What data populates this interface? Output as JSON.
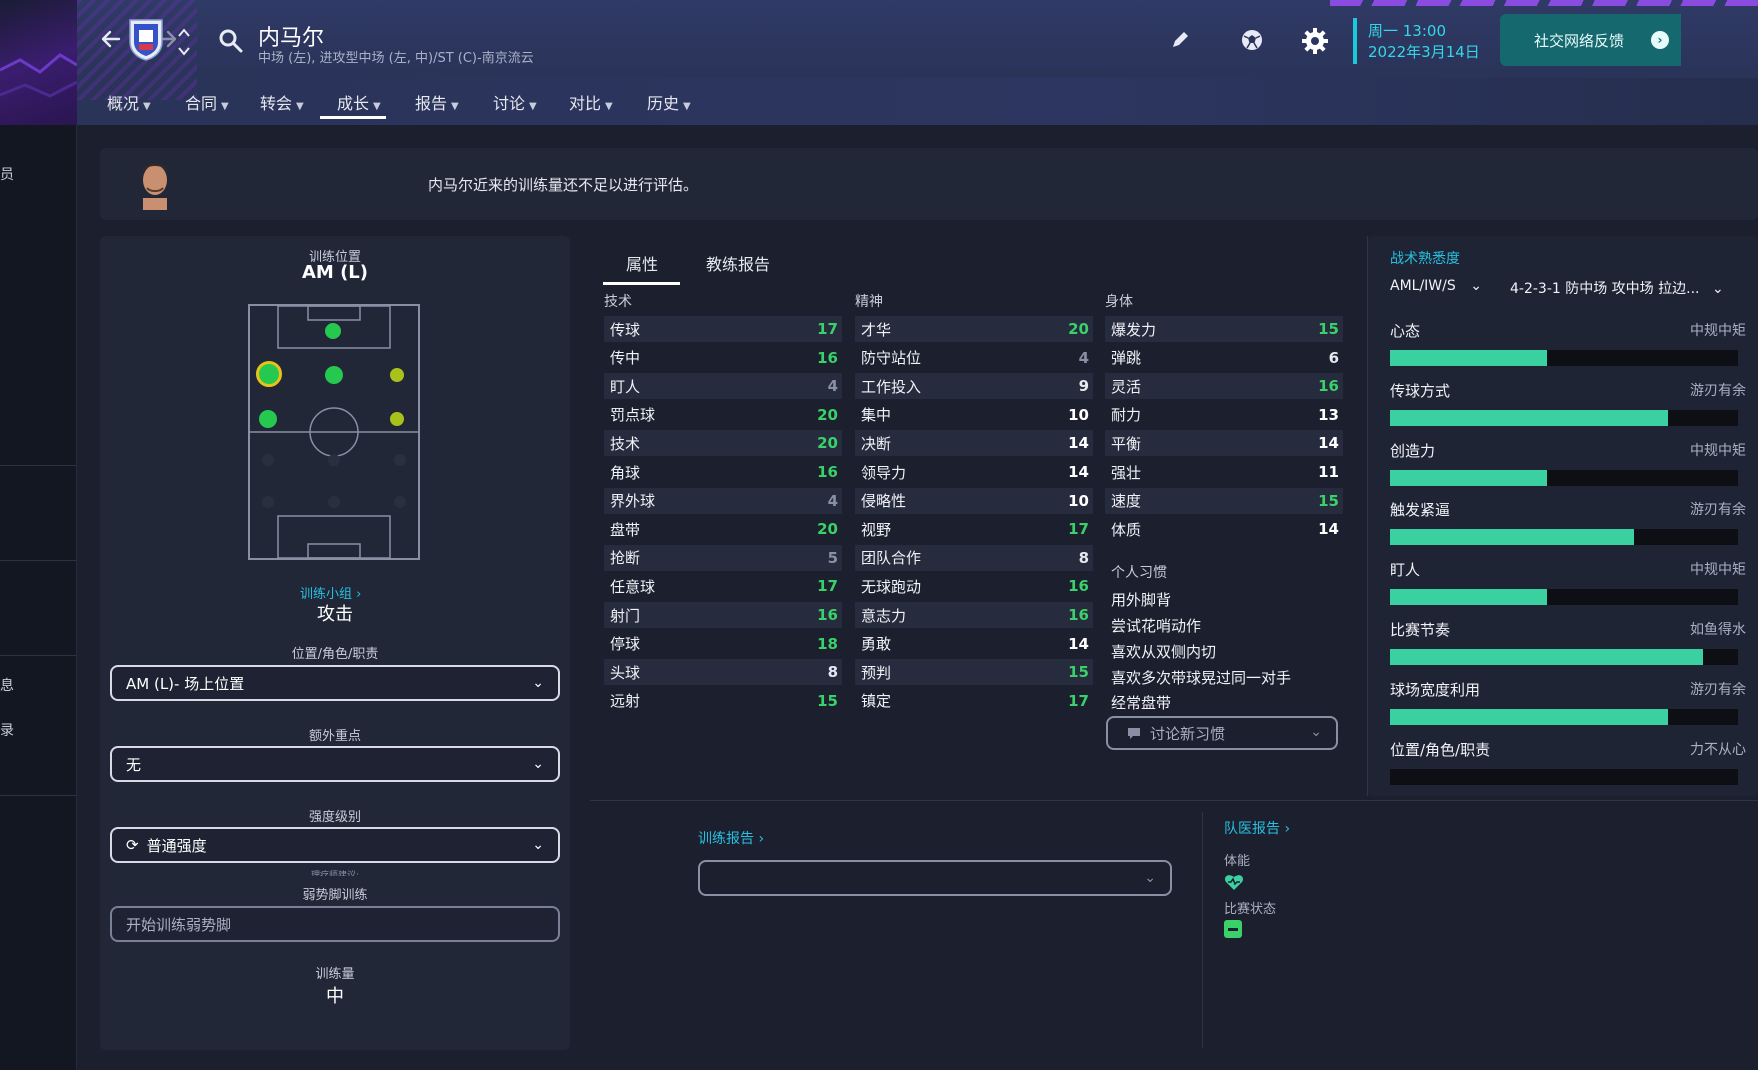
{
  "header": {
    "player_name": "内马尔",
    "player_subtitle": "中场 (左), 进攻型中场 (左, 中)/ST (C)-南京流云",
    "date_day": "周一 13:00",
    "date_full": "2022年3月14日",
    "social_button": "社交网络反馈",
    "accent_color": "#1ec8dc"
  },
  "nav": {
    "items": [
      {
        "label": "概况"
      },
      {
        "label": "合同"
      },
      {
        "label": "转会"
      },
      {
        "label": "成长"
      },
      {
        "label": "报告"
      },
      {
        "label": "讨论"
      },
      {
        "label": "对比"
      },
      {
        "label": "历史"
      }
    ],
    "active": "成长"
  },
  "message": "内马尔近来的训练量还不足以进行评估。",
  "training": {
    "position_label": "训练位置",
    "position_value": "AM (L)",
    "group_link": "训练小组",
    "group_value": "攻击",
    "role_label": "位置/角色/职责",
    "role_value": "AM (L)- 场上位置",
    "extra_label": "额外重点",
    "extra_value": "无",
    "intensity_label": "强度级别",
    "intensity_value": "普通强度",
    "coach_hint": "理疗师建议:",
    "weakfoot_label": "弱势脚训练",
    "weakfoot_placeholder": "开始训练弱势脚",
    "workload_label": "训练量",
    "workload_value": "中"
  },
  "attributes": {
    "tabs": [
      "属性",
      "教练报告"
    ],
    "headers": {
      "technical": "技术",
      "mental": "精神",
      "physical": "身体"
    },
    "technical": [
      {
        "name": "传球",
        "value": 17
      },
      {
        "name": "传中",
        "value": 16
      },
      {
        "name": "盯人",
        "value": 4
      },
      {
        "name": "罚点球",
        "value": 20
      },
      {
        "name": "技术",
        "value": 20
      },
      {
        "name": "角球",
        "value": 16
      },
      {
        "name": "界外球",
        "value": 4
      },
      {
        "name": "盘带",
        "value": 20
      },
      {
        "name": "抢断",
        "value": 5
      },
      {
        "name": "任意球",
        "value": 17
      },
      {
        "name": "射门",
        "value": 16
      },
      {
        "name": "停球",
        "value": 18
      },
      {
        "name": "头球",
        "value": 8
      },
      {
        "name": "远射",
        "value": 15
      }
    ],
    "mental": [
      {
        "name": "才华",
        "value": 20
      },
      {
        "name": "防守站位",
        "value": 4
      },
      {
        "name": "工作投入",
        "value": 9
      },
      {
        "name": "集中",
        "value": 10
      },
      {
        "name": "决断",
        "value": 14
      },
      {
        "name": "领导力",
        "value": 14
      },
      {
        "name": "侵略性",
        "value": 10
      },
      {
        "name": "视野",
        "value": 17
      },
      {
        "name": "团队合作",
        "value": 8
      },
      {
        "name": "无球跑动",
        "value": 16
      },
      {
        "name": "意志力",
        "value": 16
      },
      {
        "name": "勇敢",
        "value": 14
      },
      {
        "name": "预判",
        "value": 15
      },
      {
        "name": "镇定",
        "value": 17
      }
    ],
    "physical": [
      {
        "name": "爆发力",
        "value": 15
      },
      {
        "name": "弹跳",
        "value": 6
      },
      {
        "name": "灵活",
        "value": 16
      },
      {
        "name": "耐力",
        "value": 13
      },
      {
        "name": "平衡",
        "value": 14
      },
      {
        "name": "强壮",
        "value": 11
      },
      {
        "name": "速度",
        "value": 15
      },
      {
        "name": "体质",
        "value": 14
      }
    ],
    "habits_title": "个人习惯",
    "habits": [
      "用外脚背",
      "尝试花哨动作",
      "喜欢从双侧内切",
      "喜欢多次带球晃过同一对手",
      "经常盘带"
    ],
    "habits_button": "讨论新习惯"
  },
  "tactical": {
    "title": "战术熟悉度",
    "role_select": "AML/IW/S",
    "formation_select": "4-2-3-1 防中场 攻中场 拉边...",
    "items": [
      {
        "name": "心态",
        "value": "中规中矩",
        "level": 0.45
      },
      {
        "name": "传球方式",
        "value": "游刃有余",
        "level": 0.8
      },
      {
        "name": "创造力",
        "value": "中规中矩",
        "level": 0.45
      },
      {
        "name": "触发紧逼",
        "value": "游刃有余",
        "level": 0.7
      },
      {
        "name": "盯人",
        "value": "中规中矩",
        "level": 0.45
      },
      {
        "name": "比赛节奏",
        "value": "如鱼得水",
        "level": 0.9
      },
      {
        "name": "球场宽度利用",
        "value": "游刃有余",
        "level": 0.8
      },
      {
        "name": "位置/角色/职责",
        "value": "力不从心",
        "level": 0.0
      }
    ]
  },
  "bottom": {
    "training_report_link": "训练报告",
    "medical_report_link": "队医报告",
    "fitness_label": "体能",
    "match_condition_label": "比赛状态"
  },
  "left_hints": [
    "员",
    "息",
    "录"
  ]
}
